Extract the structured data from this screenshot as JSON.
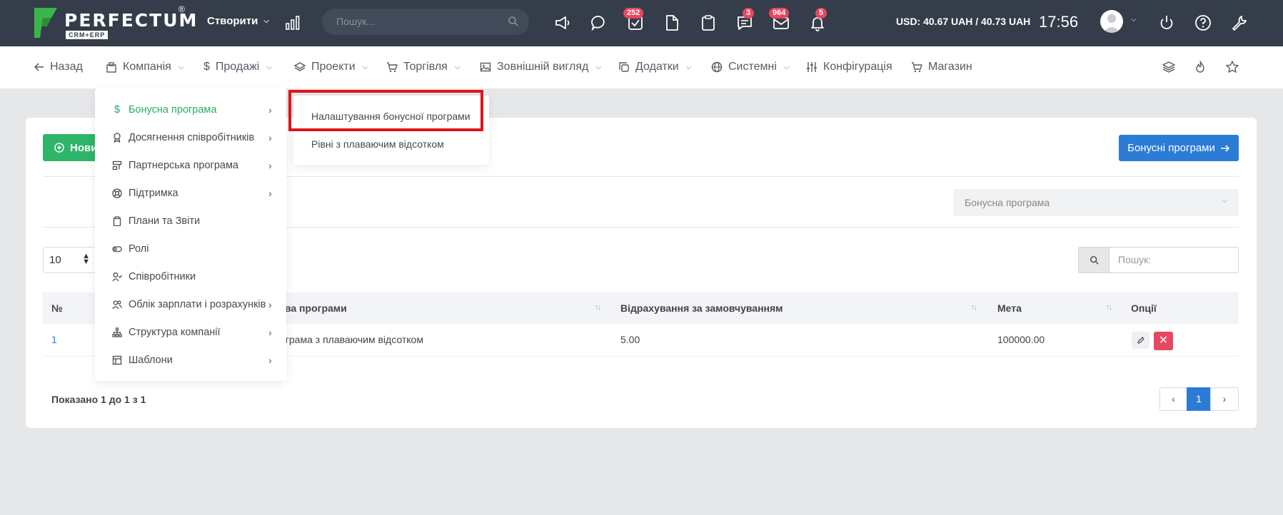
{
  "topbar": {
    "logo_text": "PERFECTUM",
    "logo_reg": "®",
    "logo_sub": "CRM+ERP",
    "create_label": "Створити",
    "search_placeholder": "Пошук...",
    "badges": {
      "tasks": "252",
      "chat": "3",
      "mail": "964",
      "notifications": "5"
    },
    "currency": "USD: 40.67 UAH / 40.73 UAH",
    "time": "17:56"
  },
  "nav": {
    "back": "Назад",
    "company": "Компанія",
    "sales": "Продажі",
    "projects": "Проекти",
    "trade": "Торгівля",
    "appearance": "Зовнішній вигляд",
    "addons": "Додатки",
    "system": "Системні",
    "config": "Конфігурація",
    "shop": "Магазин"
  },
  "dropdown": {
    "items": [
      {
        "label": "Бонусна програма",
        "icon": "dollar-icon",
        "submenu": true,
        "active": true
      },
      {
        "label": "Досягнення співробітників",
        "icon": "award-icon",
        "submenu": true
      },
      {
        "label": "Партнерська програма",
        "icon": "partner-icon",
        "submenu": true
      },
      {
        "label": "Підтримка",
        "icon": "lifebuoy-icon",
        "submenu": true
      },
      {
        "label": "Плани та Звіти",
        "icon": "clipboard-icon",
        "submenu": false
      },
      {
        "label": "Ролі",
        "icon": "toggle-icon",
        "submenu": false
      },
      {
        "label": "Співробітники",
        "icon": "user-check-icon",
        "submenu": false
      },
      {
        "label": "Облік зарплати і розрахунків",
        "icon": "users-icon",
        "submenu": true
      },
      {
        "label": "Структура компанії",
        "icon": "hierarchy-icon",
        "submenu": true
      },
      {
        "label": "Шаблони",
        "icon": "layout-icon",
        "submenu": true
      }
    ]
  },
  "submenu": {
    "items": [
      "Налаштування бонусної програми",
      "Рівні з плаваючим відсотком"
    ]
  },
  "main": {
    "new_button": "Нови",
    "programs_button": "Бонусні програми",
    "filter_placeholder": "Бонусна програма",
    "page_size": "10",
    "search_placeholder": "Пошук:",
    "columns": [
      "№",
      "зва програми",
      "Відрахування за замовчуванням",
      "Мета",
      "Опції"
    ],
    "rows": [
      {
        "id": "1",
        "name": "ограма з плаваючим відсотком",
        "deduction": "5.00",
        "goal": "100000.00"
      }
    ],
    "showing": "Показано 1 до 1 з 1",
    "current_page": "1"
  },
  "colors": {
    "topbar": "#343d49",
    "accent_green": "#2eb56a",
    "accent_blue": "#2c7cd6",
    "danger": "#e8475f",
    "highlight": "#e0131b"
  }
}
